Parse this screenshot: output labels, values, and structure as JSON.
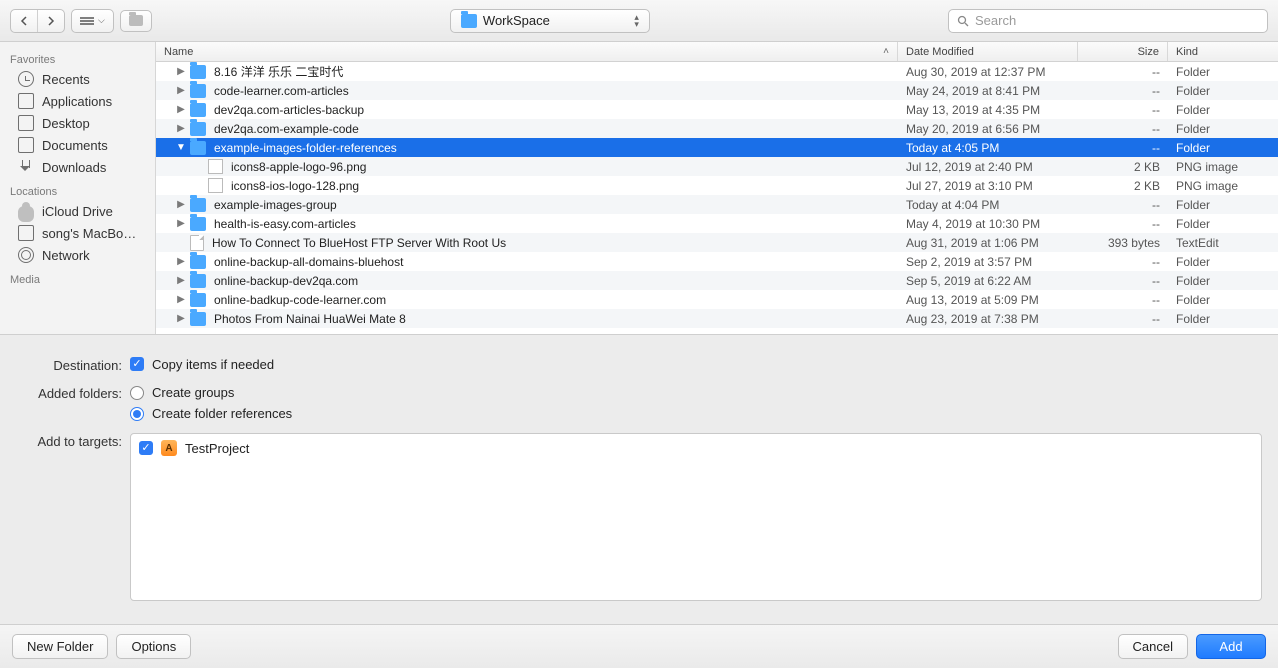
{
  "toolbar": {
    "path_label": "WorkSpace",
    "search_placeholder": "Search"
  },
  "sidebar": {
    "sections": [
      {
        "header": "Favorites",
        "items": [
          {
            "label": "Recents",
            "icon": "clock-icon"
          },
          {
            "label": "Applications",
            "icon": "app-icon"
          },
          {
            "label": "Desktop",
            "icon": "desktop-icon"
          },
          {
            "label": "Documents",
            "icon": "doc-icon"
          },
          {
            "label": "Downloads",
            "icon": "download-icon"
          }
        ]
      },
      {
        "header": "Locations",
        "items": [
          {
            "label": "iCloud Drive",
            "icon": "cloud-icon"
          },
          {
            "label": "song's MacBo…",
            "icon": "laptop-icon"
          },
          {
            "label": "Network",
            "icon": "globe-icon"
          }
        ]
      },
      {
        "header": "Media",
        "items": []
      }
    ]
  },
  "columns": {
    "name": "Name",
    "date": "Date Modified",
    "size": "Size",
    "kind": "Kind"
  },
  "rows": [
    {
      "type": "folder",
      "name": "8.16 洋洋 乐乐 二宝时代",
      "date": "Aug 30, 2019 at 12:37 PM",
      "size": "--",
      "kind": "Folder",
      "disc": "▶",
      "depth": 0
    },
    {
      "type": "folder",
      "name": "code-learner.com-articles",
      "date": "May 24, 2019 at 8:41 PM",
      "size": "--",
      "kind": "Folder",
      "disc": "▶",
      "depth": 0
    },
    {
      "type": "folder",
      "name": "dev2qa.com-articles-backup",
      "date": "May 13, 2019 at 4:35 PM",
      "size": "--",
      "kind": "Folder",
      "disc": "▶",
      "depth": 0
    },
    {
      "type": "folder",
      "name": "dev2qa.com-example-code",
      "date": "May 20, 2019 at 6:56 PM",
      "size": "--",
      "kind": "Folder",
      "disc": "▶",
      "depth": 0
    },
    {
      "type": "folder",
      "name": "example-images-folder-references",
      "date": "Today at 4:05 PM",
      "size": "--",
      "kind": "Folder",
      "disc": "▼",
      "depth": 0,
      "selected": true
    },
    {
      "type": "png",
      "name": "icons8-apple-logo-96.png",
      "date": "Jul 12, 2019 at 2:40 PM",
      "size": "2 KB",
      "kind": "PNG image",
      "disc": "",
      "depth": 1
    },
    {
      "type": "png",
      "name": "icons8-ios-logo-128.png",
      "date": "Jul 27, 2019 at 3:10 PM",
      "size": "2 KB",
      "kind": "PNG image",
      "disc": "",
      "depth": 1
    },
    {
      "type": "folder",
      "name": "example-images-group",
      "date": "Today at 4:04 PM",
      "size": "--",
      "kind": "Folder",
      "disc": "▶",
      "depth": 0
    },
    {
      "type": "folder",
      "name": "health-is-easy.com-articles",
      "date": "May 4, 2019 at 10:30 PM",
      "size": "--",
      "kind": "Folder",
      "disc": "▶",
      "depth": 0
    },
    {
      "type": "file",
      "name": "How To Connect To BlueHost FTP Server With Root Us",
      "date": "Aug 31, 2019 at 1:06 PM",
      "size": "393 bytes",
      "kind": "TextEdit",
      "disc": "",
      "depth": 0
    },
    {
      "type": "folder",
      "name": "online-backup-all-domains-bluehost",
      "date": "Sep 2, 2019 at 3:57 PM",
      "size": "--",
      "kind": "Folder",
      "disc": "▶",
      "depth": 0
    },
    {
      "type": "folder",
      "name": "online-backup-dev2qa.com",
      "date": "Sep 5, 2019 at 6:22 AM",
      "size": "--",
      "kind": "Folder",
      "disc": "▶",
      "depth": 0
    },
    {
      "type": "folder",
      "name": "online-badkup-code-learner.com",
      "date": "Aug 13, 2019 at 5:09 PM",
      "size": "--",
      "kind": "Folder",
      "disc": "▶",
      "depth": 0
    },
    {
      "type": "folder",
      "name": "Photos From Nainai HuaWei Mate 8",
      "date": "Aug 23, 2019 at 7:38 PM",
      "size": "--",
      "kind": "Folder",
      "disc": "▶",
      "depth": 0
    }
  ],
  "options": {
    "destination_label": "Destination:",
    "copy_items_label": "Copy items if needed",
    "copy_items_checked": true,
    "added_folders_label": "Added folders:",
    "create_groups_label": "Create groups",
    "create_folder_refs_label": "Create folder references",
    "folder_mode": "refs",
    "add_to_targets_label": "Add to targets:",
    "targets": [
      {
        "name": "TestProject",
        "checked": true
      }
    ]
  },
  "bottom": {
    "new_folder": "New Folder",
    "options": "Options",
    "cancel": "Cancel",
    "add": "Add"
  }
}
